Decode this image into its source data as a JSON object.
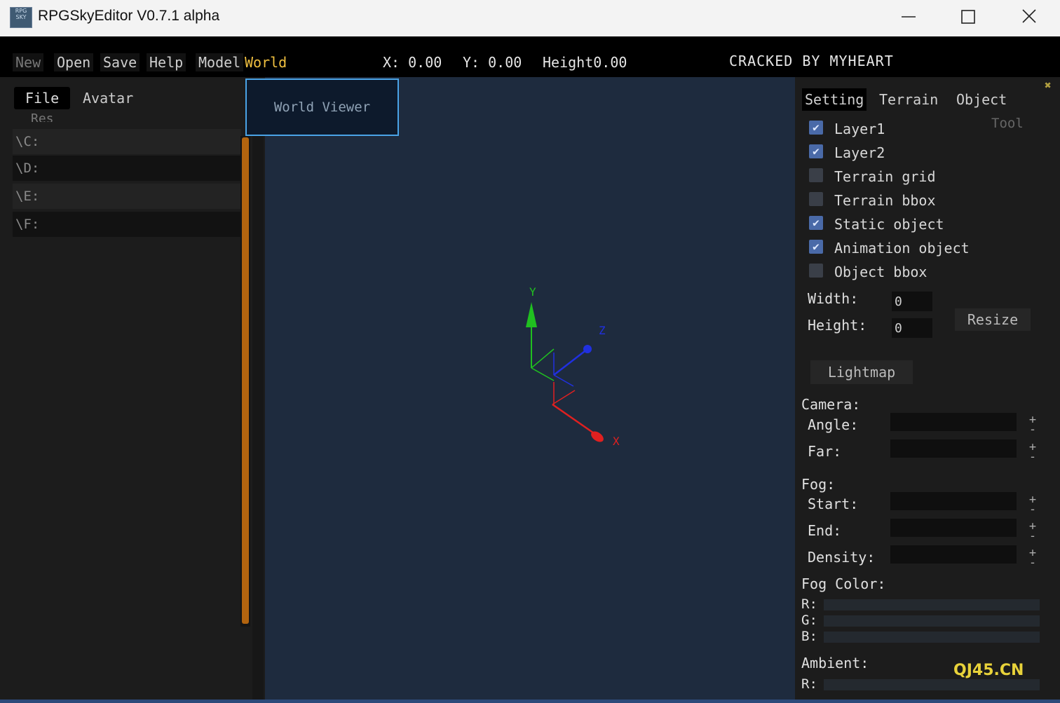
{
  "window": {
    "title": "RPGSkyEditor V0.7.1 alpha",
    "icon_text": "RPG SKY",
    "minimize_glyph": "—",
    "maximize_glyph": "☐",
    "close_glyph": "✕"
  },
  "menu": {
    "items": [
      "New",
      "Open",
      "Save",
      "Help",
      "Model",
      "World"
    ],
    "active": "World"
  },
  "status": {
    "x": "X: 0.00",
    "y": "Y: 0.00",
    "height": "Height0.00",
    "banner": "CRACKED BY MYHEART"
  },
  "left_panel": {
    "tabs": [
      "File",
      "Avatar"
    ],
    "section_label": "Res",
    "drives": [
      "\\C:",
      "\\D:",
      "\\E:",
      "\\F:"
    ]
  },
  "viewport": {
    "world_viewer_label": "World Viewer",
    "axis_labels": {
      "y": "Y",
      "z": "Z",
      "x": "X"
    },
    "axis_colors": {
      "x": "#e02020",
      "y": "#20c020",
      "z": "#2030e0"
    }
  },
  "right_panel": {
    "tabs": [
      "Setting",
      "Terrain",
      "Object"
    ],
    "tool_tab": "Tool",
    "corner_glyph": "✖",
    "layers": [
      {
        "label": "Layer1",
        "checked": true
      },
      {
        "label": "Layer2",
        "checked": true
      },
      {
        "label": "Terrain grid",
        "checked": false
      },
      {
        "label": "Terrain bbox",
        "checked": false
      },
      {
        "label": "Static object",
        "checked": true
      },
      {
        "label": "Animation object",
        "checked": true
      },
      {
        "label": "Object bbox",
        "checked": false
      }
    ],
    "check_glyph": "✔",
    "width_label": "Width:",
    "width_value": "0",
    "height_label": "Height:",
    "height_value": "0",
    "resize_label": "Resize",
    "lightmap_label": "Lightmap",
    "camera_label": "Camera:",
    "angle_label": "Angle:",
    "far_label": "Far:",
    "fog_label": "Fog:",
    "start_label": "Start:",
    "end_label": "End:",
    "density_label": "Density:",
    "fog_color_label": "Fog Color:",
    "r_label": "R:",
    "g_label": "G:",
    "b_label": "B:",
    "ambient_label": "Ambient:",
    "ambient_r_label": "R:",
    "plus": "+",
    "minus": "-"
  },
  "watermark": "QJ45.CN"
}
